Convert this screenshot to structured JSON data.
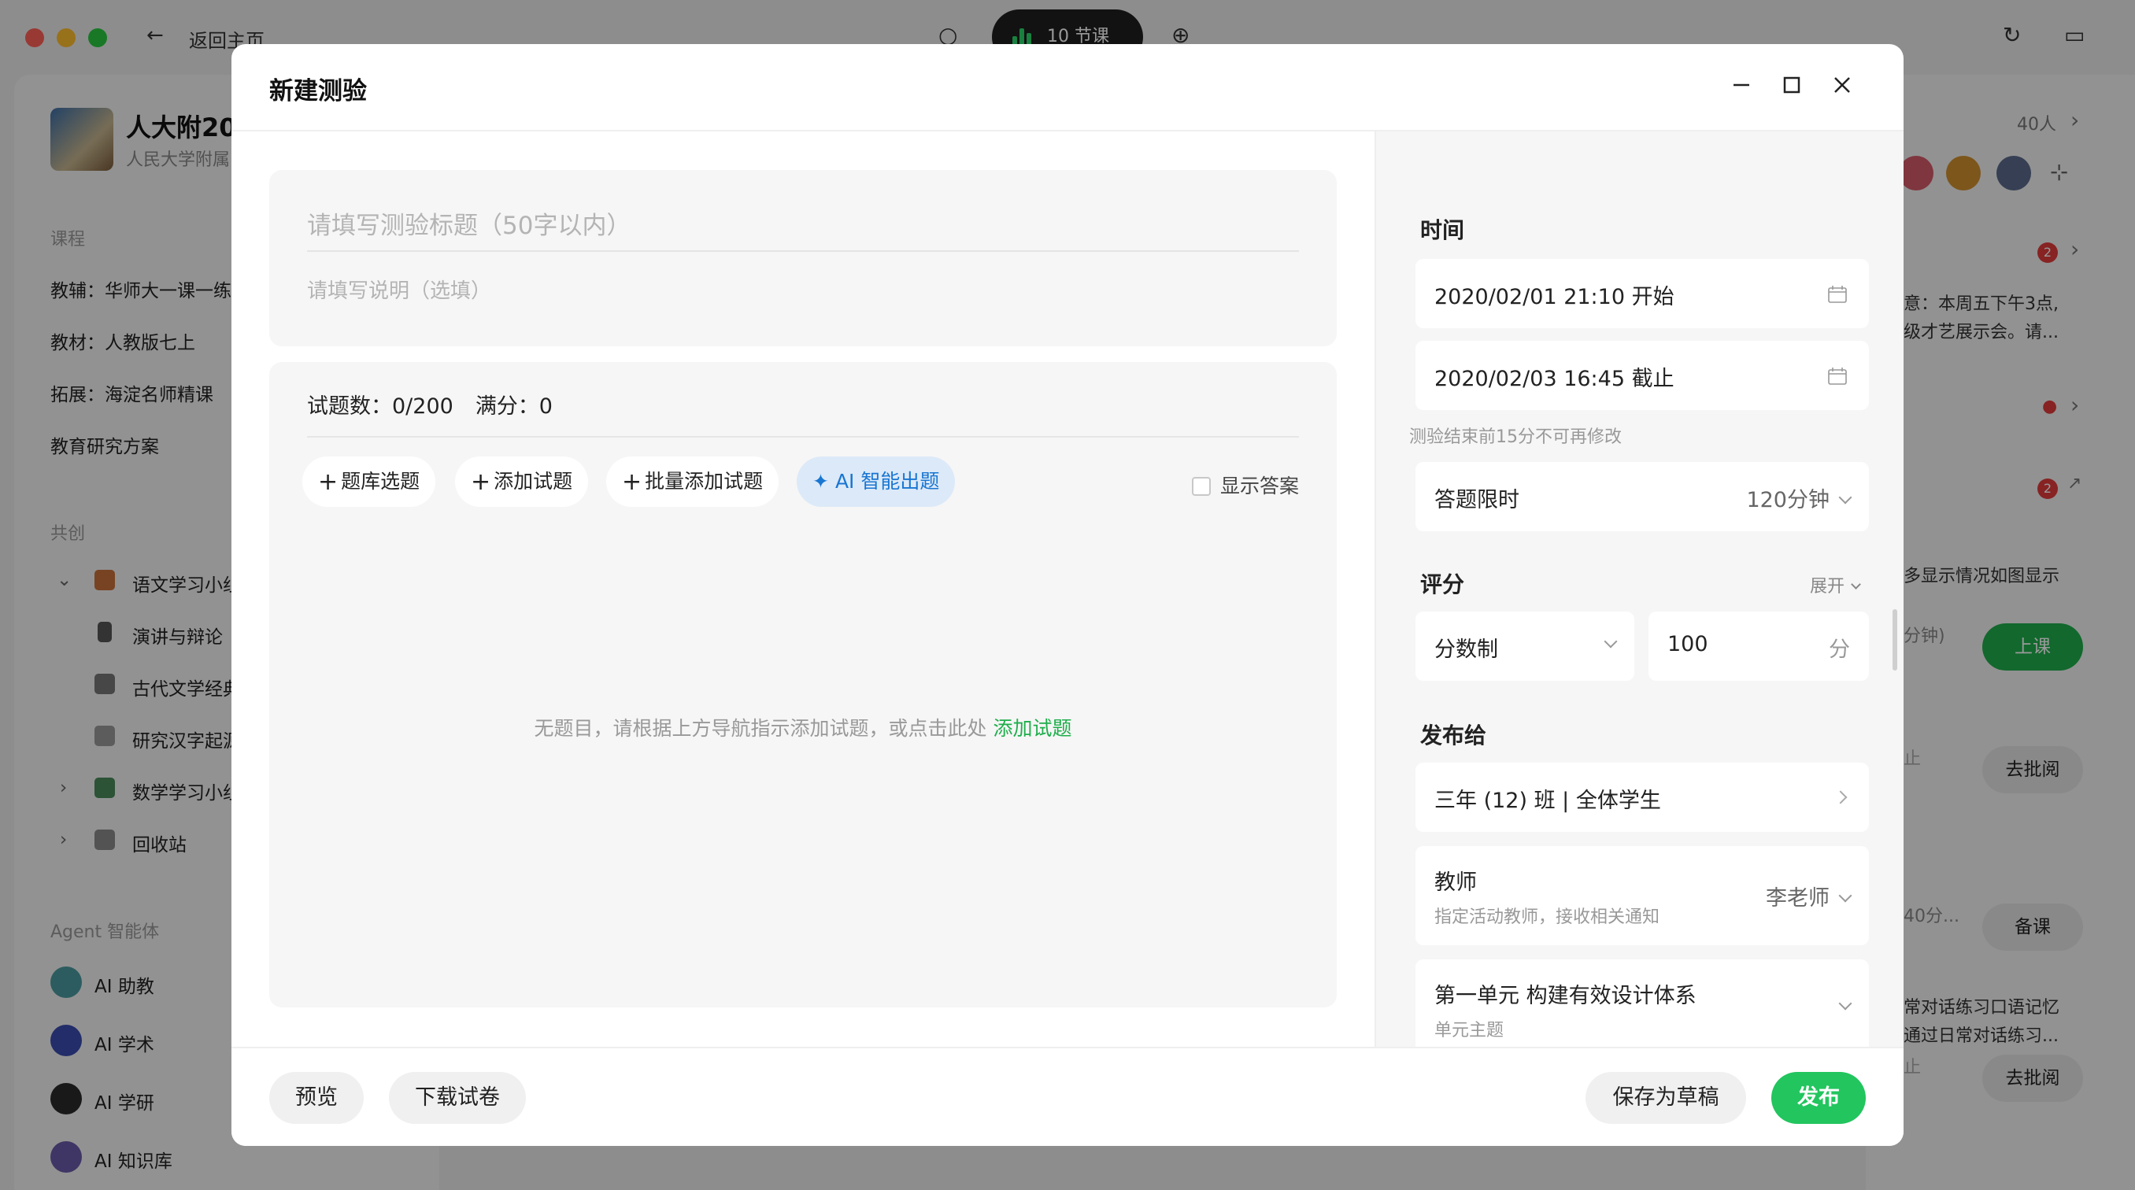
{
  "background": {
    "nav": {
      "back_label": "返回主页",
      "lesson_pill": "10 节课"
    },
    "sidebar": {
      "school_name": "人大附20",
      "school_sub": "人民大学附属",
      "course_section": "课程",
      "course_items": [
        "教辅：华师大一课一练",
        "教材：人教版七上",
        "拓展：海淀名师精课",
        "教育研究方案"
      ],
      "cocreate_section": "共创",
      "tree_items": [
        "语文学习小组",
        "演讲与辩论",
        "古代文学经典",
        "研究汉字起源",
        "数学学习小组",
        "回收站"
      ],
      "agent_section": "Agent 智能体",
      "agents": [
        "AI 助教",
        "AI 学术",
        "AI 学研",
        "AI 知识库"
      ]
    },
    "right": {
      "member_count": "40人",
      "notice_1": "意：本周五下午3点,",
      "notice_2": "级才艺展示会。请...",
      "badge_1": "2",
      "badge_2": "2",
      "text_3": "多显示情况如图显示",
      "text_4": "分钟)",
      "btn_class": "上课",
      "text_5": "止",
      "btn_review_1": "去批阅",
      "text_6": "40分...",
      "btn_prepare": "备课",
      "text_7": "常对话练习口语记忆",
      "text_8": "通过日常对话练习...",
      "text_9": "止",
      "btn_review_2": "去批阅"
    }
  },
  "modal": {
    "title": "新建测验",
    "title_placeholder": "请填写测验标题（50字以内）",
    "desc_placeholder": "请填写说明（选填）",
    "stats": {
      "count": "试题数：0/200",
      "score": "满分：0"
    },
    "toolbar": {
      "bank": "题库选题",
      "add": "添加试题",
      "batch": "批量添加试题",
      "ai": "AI 智能出题",
      "show_answer": "显示答案"
    },
    "empty": {
      "text": "无题目，请根据上方导航指示添加试题，或点击此处 ",
      "link": "添加试题"
    },
    "settings": {
      "time_label": "时间",
      "start": "2020/02/01 21:10 开始",
      "end": "2020/02/03 16:45 截止",
      "hint": "测验结束前15分不可再修改",
      "limit_label": "答题限时",
      "limit_value": "120分钟",
      "score_label": "评分",
      "expand": "展开",
      "score_type": "分数制",
      "score_value": "100",
      "score_unit": "分",
      "publish_label": "发布给",
      "publish_target": "三年 (12) 班 | 全体学生",
      "teacher_label": "教师",
      "teacher_sub": "指定活动教师，接收相关通知",
      "teacher_value": "李老师",
      "unit_title": "第一单元 构建有效设计体系",
      "unit_sub": "单元主题"
    },
    "footer": {
      "preview": "预览",
      "download": "下载试卷",
      "save_draft": "保存为草稿",
      "publish": "发布"
    }
  }
}
